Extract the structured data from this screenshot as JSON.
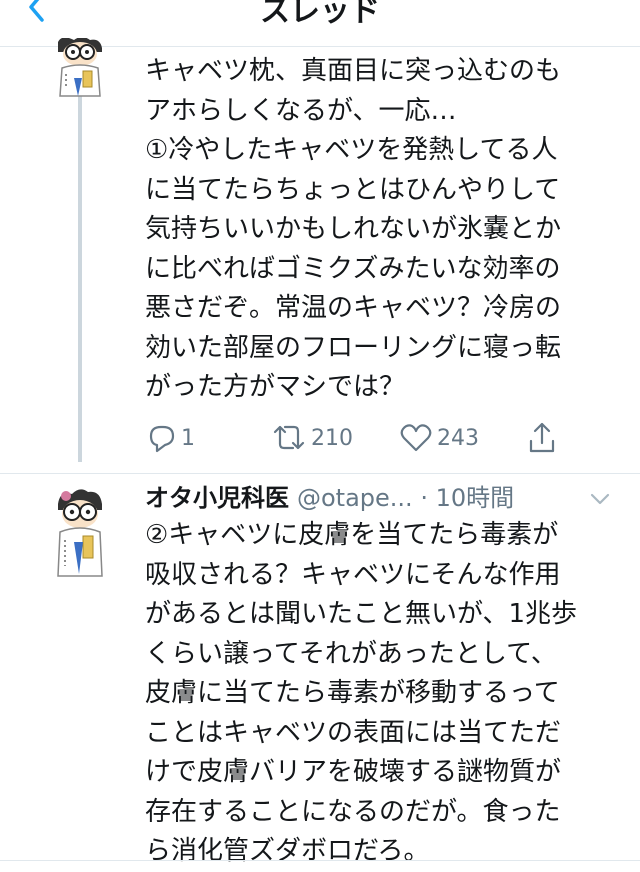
{
  "header": {
    "title": "スレッド"
  },
  "tweets": [
    {
      "text": "キャベツ枕、真面目に突っ込むのも\nアホらしくなるが、一応…\n①冷やしたキャベツを発熱してる人\nに当てたらちょっとはひんやりして\n気持ちいいかもしれないが氷嚢とか\nに比べればゴミクズみたいな効率の\n悪さだぞ。常温のキャベツ？冷房の\n効いた部屋のフローリングに寝っ転\nがった方がマシでは？",
      "actions": {
        "replies": "1",
        "retweets": "210",
        "likes": "243"
      }
    },
    {
      "author": "オタ小児科医",
      "handle": "@otape...",
      "time": "· 10時間",
      "text": "②キャベツに皮膚を当てたら毒素が\n吸収される？キャベツにそんな作用\nがあるとは聞いたこと無いが、1兆歩\nくらい譲ってそれがあったとして、\n皮膚に当てたら毒素が移動するって\nことはキャベツの表面には当てただ\nけで皮膚バリアを破壊する謎物質が\n存在することになるのだが。食った\nら消化管ズダボロだろ。"
    }
  ],
  "colors": {
    "accent": "#1da1f2",
    "secondary": "#657786",
    "line": "#ccd6dd"
  }
}
